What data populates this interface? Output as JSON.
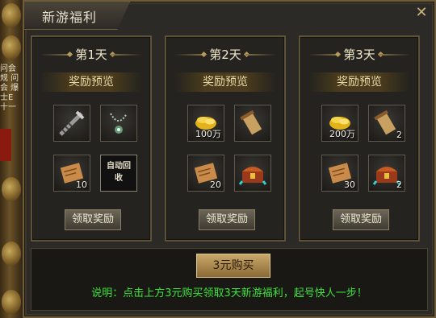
{
  "window": {
    "title": "新游福利"
  },
  "days": [
    {
      "title": "第1天",
      "preview_label": "奖励预览",
      "claim_label": "领取奖励",
      "items": [
        {
          "icon": "mace-icon",
          "count": ""
        },
        {
          "icon": "necklace-icon",
          "count": ""
        },
        {
          "icon": "scroll-icon",
          "count": "10"
        },
        {
          "icon": "auto-recycle-icon",
          "text": "自动回收",
          "count": ""
        }
      ]
    },
    {
      "title": "第2天",
      "preview_label": "奖励预览",
      "claim_label": "领取奖励",
      "items": [
        {
          "icon": "gold-coins-icon",
          "count": "100万"
        },
        {
          "icon": "scroll-bundle-icon",
          "count": ""
        },
        {
          "icon": "scroll-icon",
          "count": "20"
        },
        {
          "icon": "treasure-chest-icon",
          "count": ""
        }
      ]
    },
    {
      "title": "第3天",
      "preview_label": "奖励预览",
      "claim_label": "领取奖励",
      "items": [
        {
          "icon": "gold-coins-icon",
          "count": "200万"
        },
        {
          "icon": "scroll-bundle-icon",
          "count": "2"
        },
        {
          "icon": "scroll-icon",
          "count": "30"
        },
        {
          "icon": "treasure-chest-icon",
          "count": "2"
        }
      ]
    }
  ],
  "buy_button": "3元购买",
  "note": "说明：点击上方3元购买领取3天新游福利，起号快人一步！",
  "background_text": "问会 规 问会 爆士E 十一",
  "colors": {
    "note": "#3fe23a",
    "buy_button": "#c9a86a",
    "frame": "#6e5d38"
  }
}
